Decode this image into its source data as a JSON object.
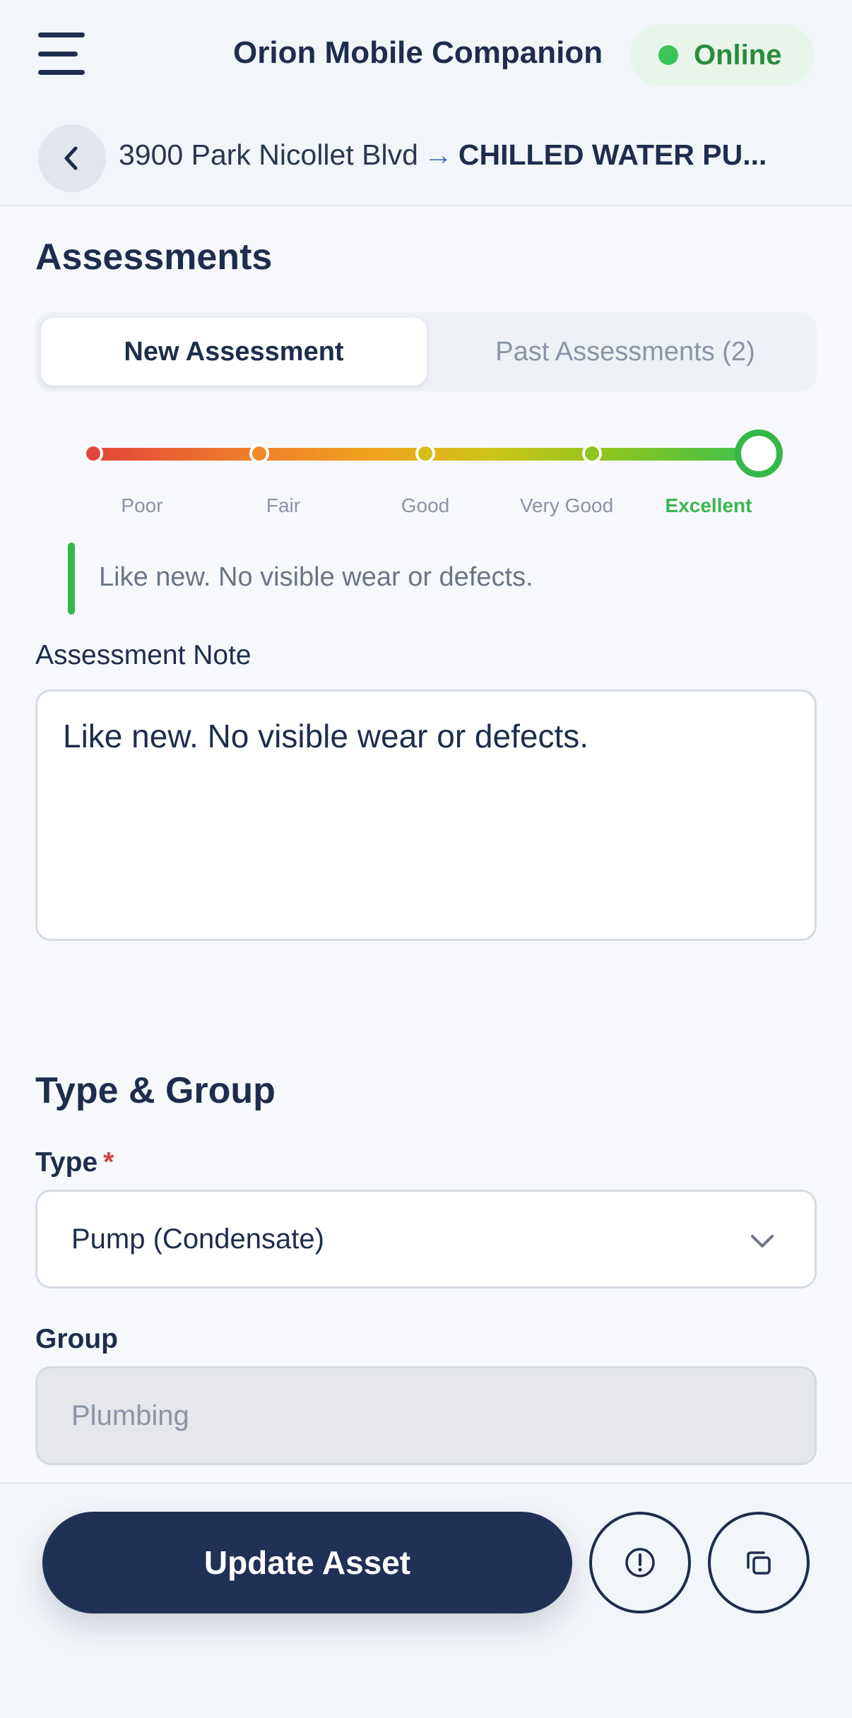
{
  "header": {
    "title": "Orion Mobile Companion",
    "status": "Online",
    "breadcrumb_location": "3900 Park Nicollet Blvd",
    "breadcrumb_arrow": "→",
    "breadcrumb_asset": "CHILLED WATER PU..."
  },
  "assessments": {
    "heading": "Assessments",
    "tabs": [
      {
        "label": "New Assessment",
        "active": true
      },
      {
        "label": "Past Assessments (2)",
        "active": false
      }
    ],
    "rating": {
      "levels": [
        "Poor",
        "Fair",
        "Good",
        "Very Good",
        "Excellent"
      ],
      "selected": "Excellent",
      "selected_index": 4
    },
    "rating_description": "Like new. No visible wear or defects.",
    "note_label": "Assessment Note",
    "note_value": "Like new. No visible wear or defects."
  },
  "type_group": {
    "heading": "Type & Group",
    "type_label": "Type",
    "required_marker": "*",
    "type_value": "Pump (Condensate)",
    "group_label": "Group",
    "group_value": "Plumbing"
  },
  "actions": {
    "primary_label": "Update Asset",
    "icons": [
      "menu-icon",
      "chevron-left-icon",
      "alert-circle-icon",
      "copy-icon",
      "chevron-down-icon"
    ]
  },
  "colors": {
    "primary": "#1f3155",
    "success": "#34b84a",
    "required": "#d64545",
    "online_bg": "#e8f5ea"
  }
}
